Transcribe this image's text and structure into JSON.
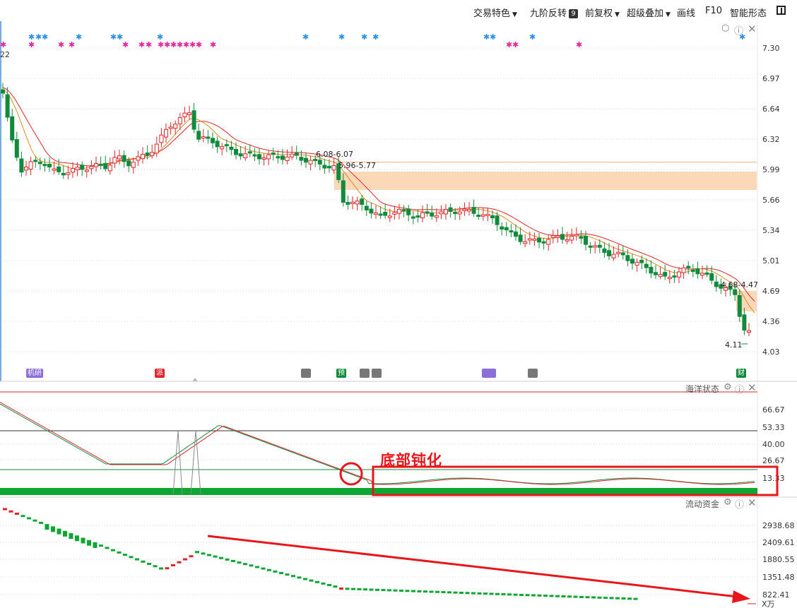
{
  "toolbar": {
    "trade_features": "交易特色",
    "nine_reversal": "九阶反转",
    "nine_badge": "9",
    "pre_adjust": "前复权",
    "super_overlay": "超级叠加",
    "draw_line": "画线",
    "f10": "F10",
    "smart_shape": "智能形态"
  },
  "price_axis": [
    "7.30",
    "6.97",
    "6.64",
    "6.32",
    "5.99",
    "5.66",
    "5.34",
    "5.01",
    "4.69",
    "4.36",
    "4.03"
  ],
  "price_annotations": {
    "top_left": "22",
    "zone1": "6.08-6.07",
    "zone2": "5.96-5.77",
    "zone3": "4.68-4.47",
    "low": "4.11"
  },
  "event_tags": [
    "机研",
    "派",
    "预",
    "财"
  ],
  "osc_panel": {
    "title": "海洋状态",
    "axis": [
      "66.67",
      "53.33",
      "40.00",
      "26.67",
      "13.33"
    ],
    "annotation": "底部钝化"
  },
  "flow_panel": {
    "title": "流动资金",
    "axis": [
      "2938.68",
      "2409.61",
      "1880.55",
      "1351.48",
      "822.41"
    ],
    "unit": "X万"
  },
  "colors": {
    "up": "#e0242b",
    "down": "#128a3c",
    "zone": "#fbd8b8",
    "ann": "#e8151b"
  }
}
